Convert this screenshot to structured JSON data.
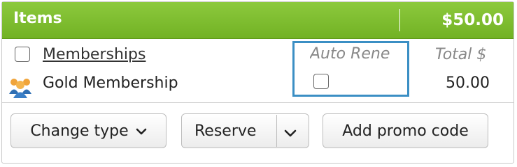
{
  "header": {
    "title": "Items",
    "total": "$50.00"
  },
  "columns": {
    "category_label": "Memberships",
    "auto_renew_label": "Auto Rene",
    "total_label": "Total $"
  },
  "items": [
    {
      "name": "Gold Membership",
      "price": "50.00",
      "icon": "people-group-icon",
      "auto_renew": false
    }
  ],
  "buttons": {
    "change_type": "Change type",
    "reserve": "Reserve",
    "add_promo": "Add promo code"
  },
  "colors": {
    "header_green": "#7dbd2f",
    "highlight_blue": "#3b8fc4"
  }
}
